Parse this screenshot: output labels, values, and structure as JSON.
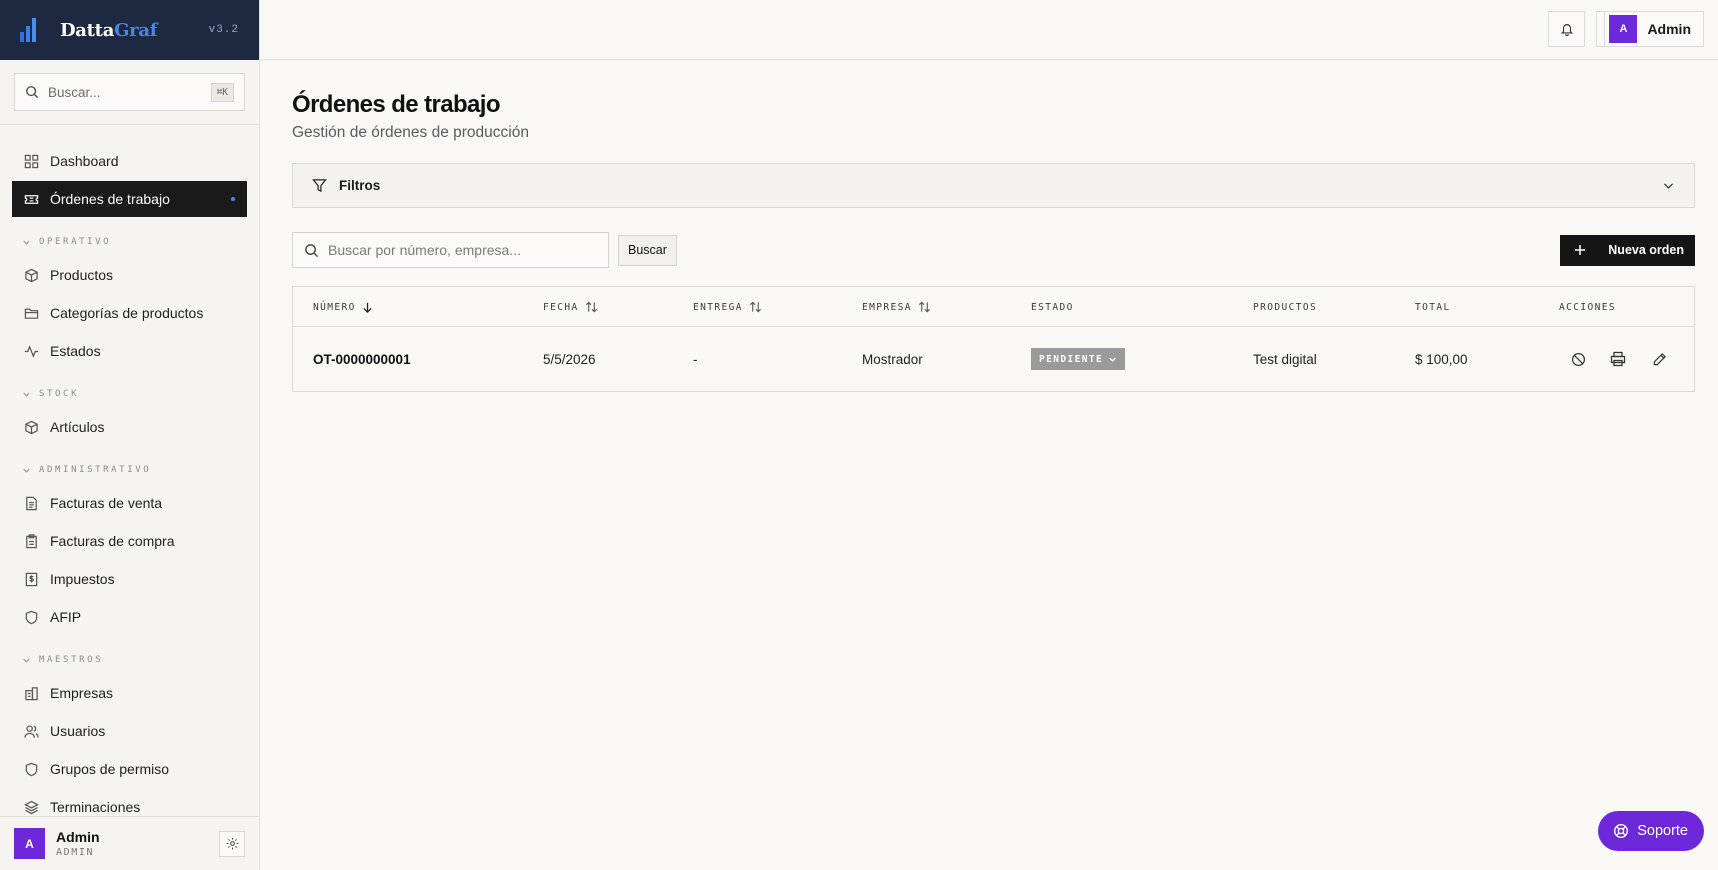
{
  "brand": {
    "name_main": "Datta",
    "name_accent": "Graf",
    "version": "v3.2"
  },
  "sidebar": {
    "search_placeholder": "Buscar...",
    "search_shortcut": "⌘K",
    "items_top": [
      {
        "label": "Dashboard",
        "icon": "grid-icon"
      },
      {
        "label": "Órdenes de trabajo",
        "icon": "ticket-icon",
        "active": true
      }
    ],
    "sections": {
      "operativo": {
        "label": "OPERATIVO",
        "items": [
          "Productos",
          "Categorías de productos",
          "Estados"
        ]
      },
      "stock": {
        "label": "STOCK",
        "items": [
          "Artículos"
        ]
      },
      "administrativo": {
        "label": "ADMINISTRATIVO",
        "items": [
          "Facturas de venta",
          "Facturas de compra",
          "Impuestos",
          "AFIP"
        ]
      },
      "maestros": {
        "label": "MAESTROS",
        "items": [
          "Empresas",
          "Usuarios",
          "Grupos de permiso",
          "Terminaciones"
        ]
      }
    },
    "user": {
      "initial": "A",
      "name": "Admin",
      "role": "ADMIN"
    }
  },
  "topbar": {
    "user_initial": "A",
    "user_name": "Admin"
  },
  "page": {
    "title": "Órdenes de trabajo",
    "subtitle": "Gestión de órdenes de producción"
  },
  "filters": {
    "label": "Filtros"
  },
  "toolbar": {
    "search_placeholder": "Buscar por número, empresa...",
    "search_button": "Buscar",
    "new_button": "Nueva orden"
  },
  "table": {
    "columns": [
      "NÚMERO",
      "FECHA",
      "ENTREGA",
      "EMPRESA",
      "ESTADO",
      "PRODUCTOS",
      "TOTAL",
      "ACCIONES"
    ],
    "rows": [
      {
        "numero": "OT-0000000001",
        "fecha": "5/5/2026",
        "entrega": "-",
        "empresa": "Mostrador",
        "estado": "PENDIENTE",
        "productos": "Test digital",
        "total": "$ 100,00"
      }
    ]
  },
  "support": {
    "label": "Soporte"
  },
  "colors": {
    "brand_bar": "#1c2940",
    "brand_accent": "#4a86e8",
    "purple": "#6d28d9",
    "active_nav": "#1a1a1a",
    "status_pending": "#9a9a9a"
  }
}
